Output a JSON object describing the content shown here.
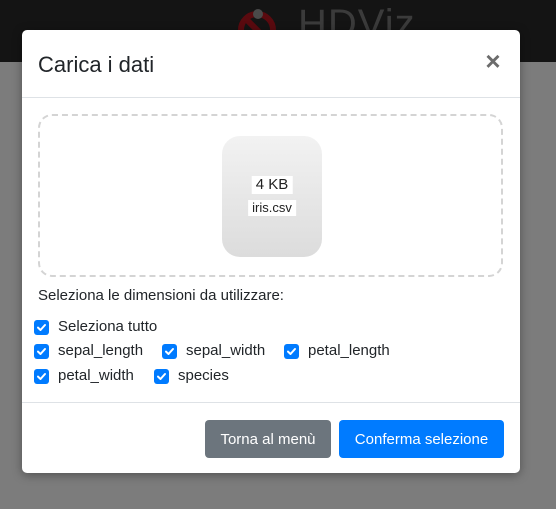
{
  "app": {
    "logo_text": "HDViz"
  },
  "modal": {
    "title": "Carica i dati",
    "close_symbol": "×",
    "file": {
      "size": "4 KB",
      "name": "iris.csv"
    },
    "dimensions_label": "Seleziona le dimensioni da utilizzare:",
    "select_all": {
      "label": "Seleziona tutto",
      "checked": true
    },
    "dimensions": [
      {
        "label": "sepal_length",
        "checked": true
      },
      {
        "label": "sepal_width",
        "checked": true
      },
      {
        "label": "petal_length",
        "checked": true
      },
      {
        "label": "petal_width",
        "checked": true
      },
      {
        "label": "species",
        "checked": true
      }
    ],
    "buttons": {
      "back": "Torna al menù",
      "confirm": "Conferma selezione"
    }
  },
  "colors": {
    "primary": "#007bff",
    "secondary": "#6c757d",
    "logo_red": "#d0021b"
  }
}
